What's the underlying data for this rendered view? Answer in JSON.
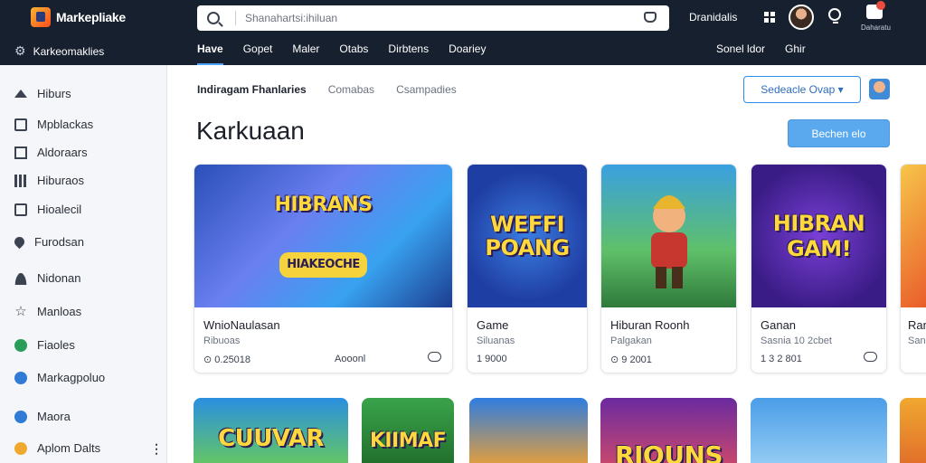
{
  "brand": {
    "name": "Markepliake"
  },
  "sidebar_header": {
    "label": "Karkeomaklies"
  },
  "search": {
    "placeholder": "Shanahartsi:ihiluan"
  },
  "top_right": {
    "label": "Dranidalis",
    "store_label": "Daharatu"
  },
  "nav": {
    "tabs": [
      "Have",
      "Gopet",
      "Maler",
      "Otabs",
      "Dirbtens",
      "Doariey"
    ],
    "right_links": [
      "Sonel ldor",
      "Ghir"
    ]
  },
  "sidebar": {
    "items": [
      {
        "label": "Hiburs",
        "icon": "house-icon"
      },
      {
        "label": "Mpblackas",
        "icon": "book-icon"
      },
      {
        "label": "Aldoraars",
        "icon": "monitor-icon"
      },
      {
        "label": "Hiburaos",
        "icon": "grid-icon"
      },
      {
        "label": "Hioalecil",
        "icon": "square-icon"
      },
      {
        "label": "Furodsan",
        "icon": "pin-icon"
      },
      {
        "label": "Nidonan",
        "icon": "person-icon"
      },
      {
        "label": "Manloas",
        "icon": "star-icon"
      },
      {
        "label": "Fiaoles",
        "icon": "green-circle-icon"
      },
      {
        "label": "Markagpoluo",
        "icon": "blue-circle-icon"
      },
      {
        "label": "Maora",
        "icon": "blue-dot-icon"
      },
      {
        "label": "Aplom Dalts",
        "icon": "yellow-circle-icon"
      }
    ]
  },
  "filters": {
    "items": [
      "Indiragam Fhanlaries",
      "Comabas",
      "Csampadies"
    ],
    "select_label": "Sedeacle Ovap ▾"
  },
  "section": {
    "title": "Karkuaan",
    "button": "Bechen elo"
  },
  "cards": [
    {
      "art": "HIBRANS",
      "art2": "HIAKEOCHE",
      "title": "WnioNaulasan",
      "subtitle": "Ribuoas",
      "meta": "⊙ 0.25018",
      "extra": "Aooonl"
    },
    {
      "art": "WEFFI POANG",
      "title": "Game",
      "subtitle": "Siluanas",
      "meta": "1 9000"
    },
    {
      "art": "",
      "title": "Hiburan Roonh",
      "subtitle": "Palgakan",
      "meta": "⊙ 9 2001"
    },
    {
      "art": "HIBRAN GAM!",
      "title": "Ganan",
      "subtitle": "Sasnia 10 2cbet",
      "meta": "1 3 2 801"
    },
    {
      "art": "",
      "title": "Ran",
      "subtitle": "San",
      "meta": ""
    }
  ],
  "cards_row2": [
    {
      "art": "CUUVAR"
    },
    {
      "art": "KIIMAF"
    },
    {
      "art": ""
    },
    {
      "art": "RIOUNS"
    },
    {
      "art": ""
    }
  ],
  "colors": {
    "topbar": "#17202e",
    "accent": "#5aa9ee",
    "sidebar_bg": "#f4f6f9"
  }
}
